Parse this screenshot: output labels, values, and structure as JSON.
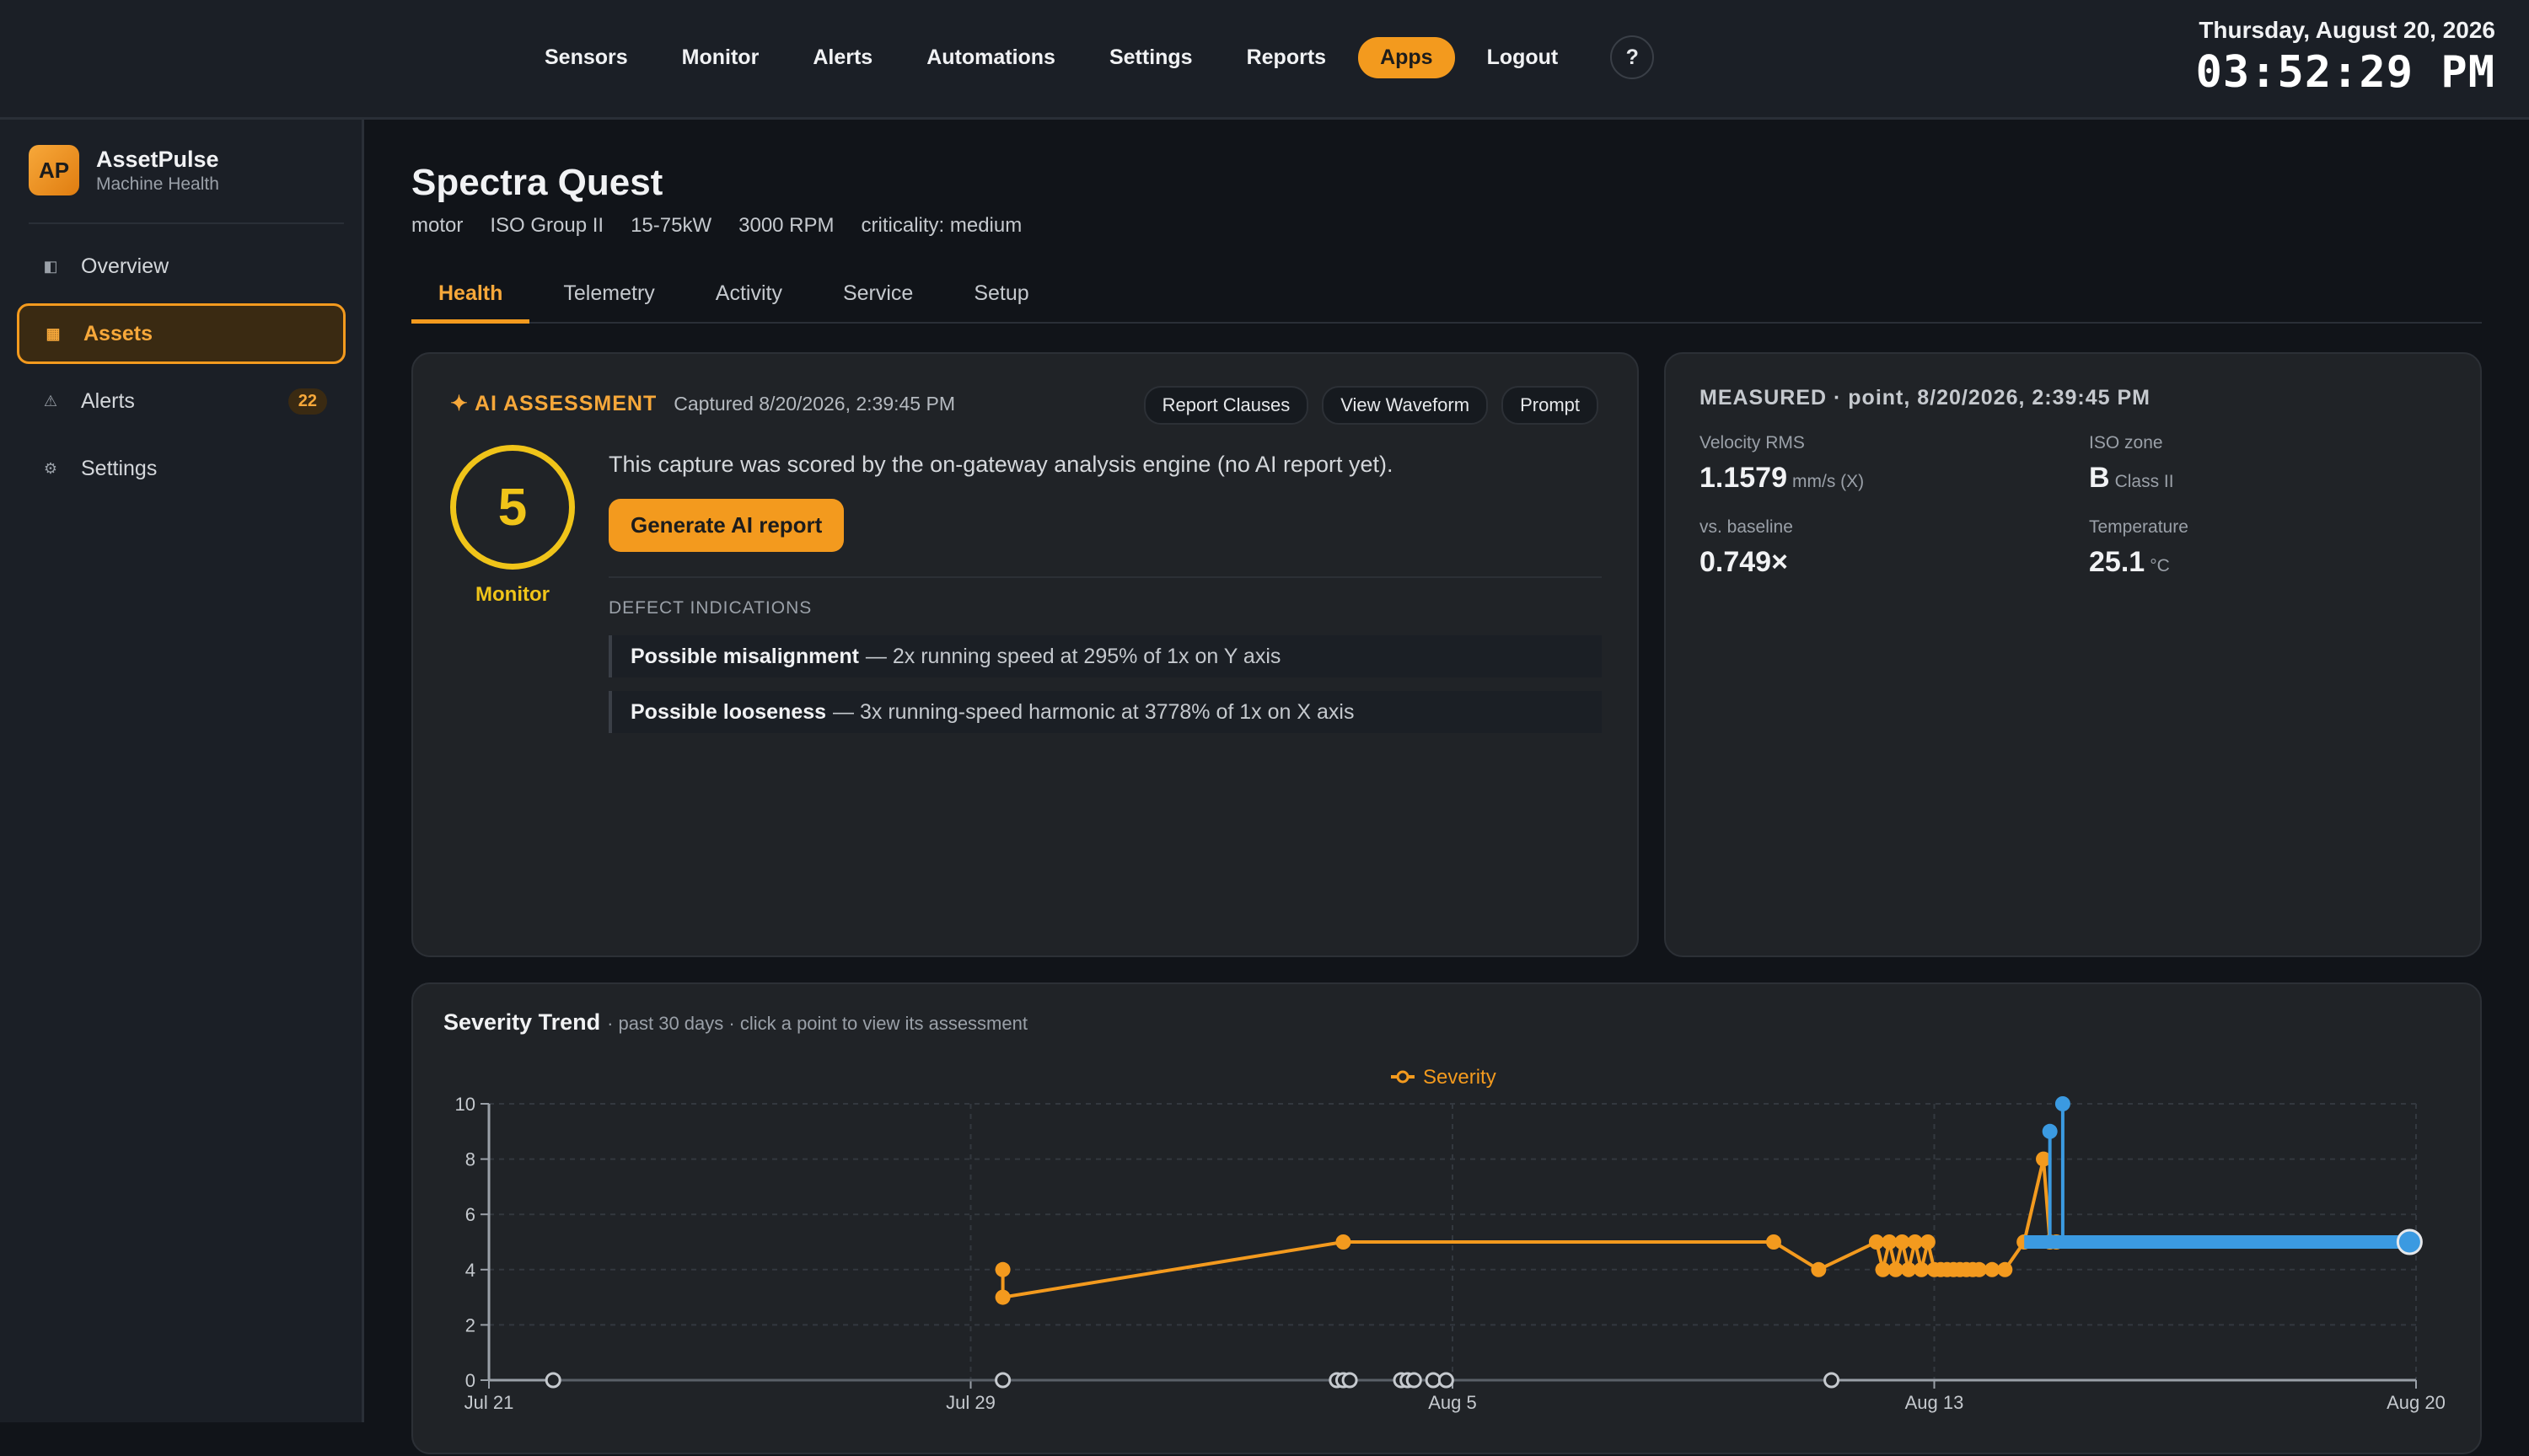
{
  "topnav": {
    "items": [
      "Sensors",
      "Monitor",
      "Alerts",
      "Automations",
      "Settings",
      "Reports",
      "Apps",
      "Logout"
    ],
    "active": "Apps",
    "help_label": "?"
  },
  "clock": {
    "date": "Thursday, August 20, 2026",
    "time": "03:52:29 PM"
  },
  "brand": {
    "logo": "AP",
    "name": "AssetPulse",
    "subtitle": "Machine Health"
  },
  "sidebar": {
    "items": [
      {
        "label": "Overview",
        "icon": "overview-icon",
        "glyph": "◧"
      },
      {
        "label": "Assets",
        "icon": "assets-icon",
        "glyph": "▦",
        "active": true
      },
      {
        "label": "Alerts",
        "icon": "alert-triangle-icon",
        "glyph": "⚠",
        "badge": "22"
      },
      {
        "label": "Settings",
        "icon": "gear-icon",
        "glyph": "⚙"
      }
    ]
  },
  "asset": {
    "title": "Spectra Quest",
    "meta": [
      "motor",
      "ISO Group II",
      "15-75kW",
      "3000 RPM",
      "criticality: medium"
    ]
  },
  "tabs": [
    "Health",
    "Telemetry",
    "Activity",
    "Service",
    "Setup"
  ],
  "active_tab": "Health",
  "ai": {
    "label": "✦ AI ASSESSMENT",
    "captured": "Captured 8/20/2026, 2:39:45 PM",
    "actions": [
      "Report Clauses",
      "View Waveform",
      "Prompt"
    ],
    "score": "5",
    "score_label": "Monitor",
    "message": "This capture was scored by the on-gateway analysis engine (no AI report yet).",
    "generate_label": "Generate AI report",
    "defects_title": "DEFECT INDICATIONS",
    "defects": [
      {
        "title": "Possible misalignment",
        "detail": "— 2x running speed at 295% of 1x on Y axis"
      },
      {
        "title": "Possible looseness",
        "detail": "— 3x running-speed harmonic at 3778% of 1x on X axis"
      }
    ],
    "score_color": "#f0c419"
  },
  "measured": {
    "header": "MEASURED · point, 8/20/2026, 2:39:45 PM",
    "velocity": {
      "label": "Velocity RMS",
      "value": "1.1579",
      "unit": "mm/s (X)"
    },
    "iso_zone": {
      "label": "ISO zone",
      "value": "B",
      "unit": "Class II"
    },
    "baseline": {
      "label": "vs. baseline",
      "value": "0.749×"
    },
    "temperature": {
      "label": "Temperature",
      "value": "25.1",
      "unit": "°C"
    }
  },
  "trend": {
    "title": "Severity Trend",
    "subtitle": "· past 30 days · click a point to view its assessment"
  },
  "chart_data": {
    "type": "line",
    "legend": "Severity",
    "legend_position": "top-center",
    "x_ticks": [
      "Jul 21",
      "Jul 29",
      "Aug 5",
      "Aug 13",
      "Aug 20"
    ],
    "y_ticks": [
      0,
      2,
      4,
      6,
      8,
      10
    ],
    "ylim": [
      0,
      10
    ],
    "xlim_days": [
      0,
      30
    ],
    "grid": true,
    "colors": {
      "orange": "#f39a1e",
      "blue": "#3b9ae1",
      "zero": "#9aa0a8"
    },
    "series": [
      {
        "color": "orange",
        "x": [
          8.0,
          8.0,
          13.3,
          20.0,
          20.7,
          21.6,
          21.7,
          21.8,
          21.9,
          22.0,
          22.1,
          22.2,
          22.3,
          22.4,
          22.5,
          22.6,
          22.7,
          22.8,
          22.9,
          23.0,
          23.1,
          23.2,
          23.4,
          23.6,
          23.9,
          24.2,
          24.3,
          24.4
        ],
        "y": [
          4,
          3,
          5,
          5,
          4,
          5,
          4,
          5,
          4,
          5,
          4,
          5,
          4,
          5,
          4,
          4,
          4,
          4,
          4,
          4,
          4,
          4,
          4,
          4,
          5,
          8,
          5,
          5
        ]
      },
      {
        "color": "blue",
        "x": [
          23.9,
          24.5,
          25.0,
          26.0,
          27.0,
          28.0,
          29.0,
          29.9
        ],
        "y": [
          5,
          5,
          5,
          5,
          5,
          5,
          5,
          5
        ],
        "spikes": [
          {
            "x": 24.3,
            "y": 9
          },
          {
            "x": 24.5,
            "y": 10
          }
        ]
      },
      {
        "color": "zero",
        "x": [
          1.0,
          8.0,
          13.2,
          13.3,
          13.4,
          14.2,
          14.3,
          14.4,
          14.7,
          14.9,
          20.9
        ],
        "y": [
          0,
          0,
          0,
          0,
          0,
          0,
          0,
          0,
          0,
          0,
          0
        ]
      }
    ]
  }
}
